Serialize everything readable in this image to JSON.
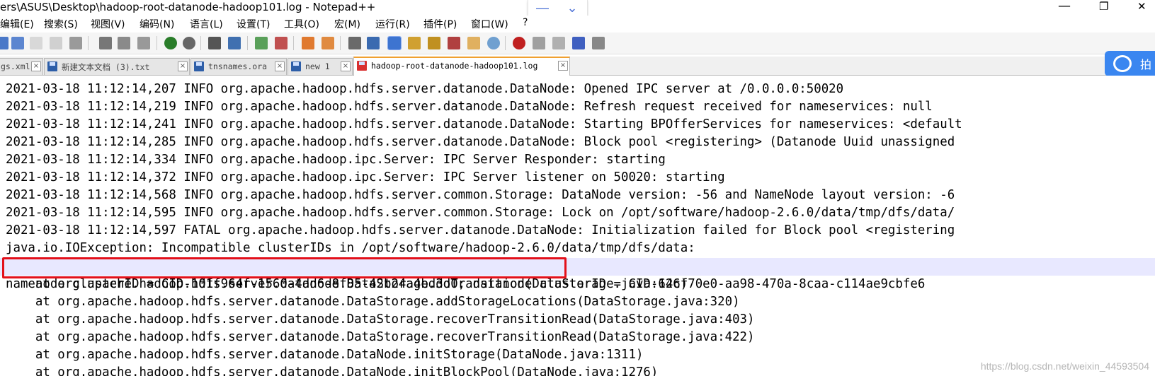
{
  "window": {
    "title": "ers\\ASUS\\Desktop\\hadoop-root-datanode-hadoop101.log - Notepad++",
    "minimize_glyph": "—",
    "restore_glyph": "❐",
    "close_glyph": "✕"
  },
  "ime": {
    "minus_glyph": "—",
    "down_glyph": "⌄"
  },
  "menu": {
    "items": [
      {
        "label": "编辑(E)"
      },
      {
        "label": "搜索(S)"
      },
      {
        "label": "视图(V)"
      },
      {
        "label": "编码(N)"
      },
      {
        "label": "语言(L)"
      },
      {
        "label": "设置(T)"
      },
      {
        "label": "工具(O)"
      },
      {
        "label": "宏(M)"
      },
      {
        "label": "运行(R)"
      },
      {
        "label": "插件(P)"
      },
      {
        "label": "窗口(W)"
      },
      {
        "label": "?"
      }
    ]
  },
  "tabs": [
    {
      "label": "gs.xml",
      "active": false
    },
    {
      "label": "新建文本文档 (3).txt",
      "active": false
    },
    {
      "label": "tnsnames.ora",
      "active": false
    },
    {
      "label": "new 1",
      "active": false
    },
    {
      "label": "hadoop-root-datanode-hadoop101.log",
      "active": true
    }
  ],
  "float_button": {
    "hint": "拍"
  },
  "editor": {
    "lines": [
      "2021-03-18 11:12:14,207 INFO org.apache.hadoop.hdfs.server.datanode.DataNode: Opened IPC server at /0.0.0.0:50020",
      "2021-03-18 11:12:14,219 INFO org.apache.hadoop.hdfs.server.datanode.DataNode: Refresh request received for nameservices: null",
      "2021-03-18 11:12:14,241 INFO org.apache.hadoop.hdfs.server.datanode.DataNode: Starting BPOfferServices for nameservices: <default",
      "2021-03-18 11:12:14,285 INFO org.apache.hadoop.hdfs.server.datanode.DataNode: Block pool <registering> (Datanode Uuid unassigned",
      "2021-03-18 11:12:14,334 INFO org.apache.hadoop.ipc.Server: IPC Server Responder: starting",
      "2021-03-18 11:12:14,372 INFO org.apache.hadoop.ipc.Server: IPC Server listener on 50020: starting",
      "2021-03-18 11:12:14,568 INFO org.apache.hadoop.hdfs.server.common.Storage: DataNode version: -56 and NameNode layout version: -6",
      "2021-03-18 11:12:14,595 INFO org.apache.hadoop.hdfs.server.common.Storage: Lock on /opt/software/hadoop-2.6.0/data/tmp/dfs/data/",
      "2021-03-18 11:12:14,597 FATAL org.apache.hadoop.hdfs.server.datanode.DataNode: Initialization failed for Block pool <registering",
      "java.io.IOException: Incompatible clusterIDs in /opt/software/hadoop-2.6.0/data/tmp/dfs/data:",
      "namenode clusterID = CID-101f964f-1560-4dd6-8f85-42b24a4bd3d0; datanode clusterID = CID-12cf70e0-aa98-470a-8caa-c114ae9cbfe6",
      "    at org.apache.hadoop.hdfs.server.datanode.DataStorage.doTransition(DataStorage.java:646)",
      "    at org.apache.hadoop.hdfs.server.datanode.DataStorage.addStorageLocations(DataStorage.java:320)",
      "    at org.apache.hadoop.hdfs.server.datanode.DataStorage.recoverTransitionRead(DataStorage.java:403)",
      "    at org.apache.hadoop.hdfs.server.datanode.DataStorage.recoverTransitionRead(DataStorage.java:422)",
      "    at org.apache.hadoop.hdfs.server.datanode.DataNode.initStorage(DataNode.java:1311)",
      "    at org.apache.hadoop.hdfs.server.datanode.DataNode.initBlockPool(DataNode.java:1276)"
    ]
  },
  "watermark": "https://blog.csdn.net/weixin_44593504",
  "colors": {
    "highlight_row": "#e8e8ff",
    "annotation_box": "#e3101a",
    "active_tab_accent": "#f0a030"
  }
}
